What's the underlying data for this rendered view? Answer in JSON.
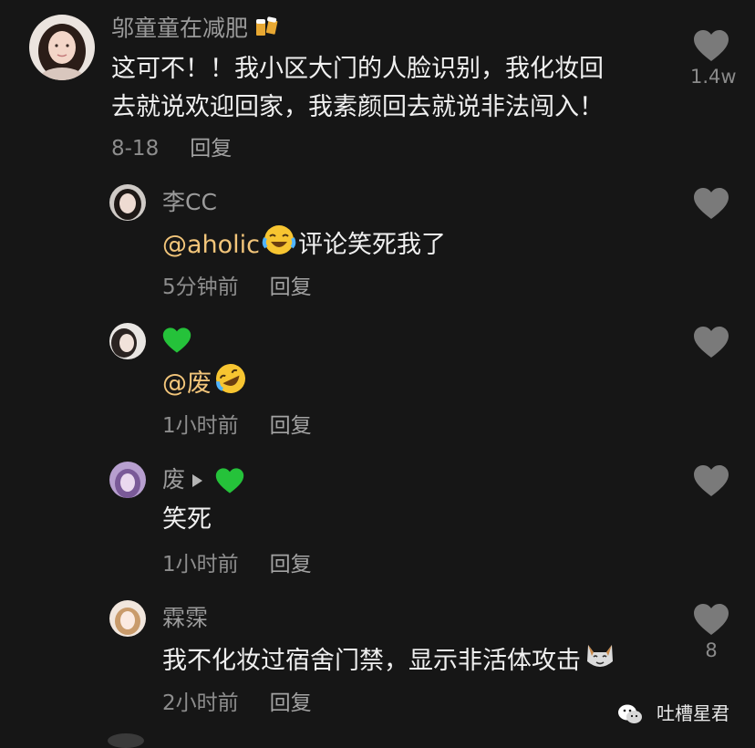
{
  "colors": {
    "background": "#161616",
    "username": "#9b9b9b",
    "text": "#f0f0f0",
    "mention": "#f2c57a",
    "meta": "#8d8d8d",
    "heart": "#7a7a7a",
    "green_heart": "#25c23a"
  },
  "comments": [
    {
      "username": "邬童童在减肥",
      "badge_icon": "beer-mugs-emoji",
      "text": "这可不！！我小区大门的人脸识别，我化妆回",
      "text_line2": "去就说欢迎回家，我素颜回去就说非法闯入！",
      "time": "8-18",
      "reply": "回复",
      "likes": "1.4w"
    },
    {
      "username": "李CC",
      "mention": "@aholic",
      "emoji_icon": "crying-laughing-emoji",
      "text": "评论笑死我了",
      "time": "5分钟前",
      "reply": "回复"
    },
    {
      "username_icon": "green-heart-emoji",
      "mention": "@废",
      "emoji_icon": "rolling-laughing-emoji",
      "time": "1小时前",
      "reply": "回复"
    },
    {
      "username": "废",
      "reply_to_icon": "green-heart-emoji",
      "text": "笑死",
      "time": "1小时前",
      "reply": "回复"
    },
    {
      "username": "霖霂",
      "text": "我不化妆过宿舍门禁，显示非活体攻击",
      "emoji_icon": "cat-face-emoji",
      "time": "2小时前",
      "reply": "回复",
      "likes": "8"
    }
  ],
  "watermark": {
    "icon": "wechat-icon",
    "text": "吐槽星君"
  }
}
